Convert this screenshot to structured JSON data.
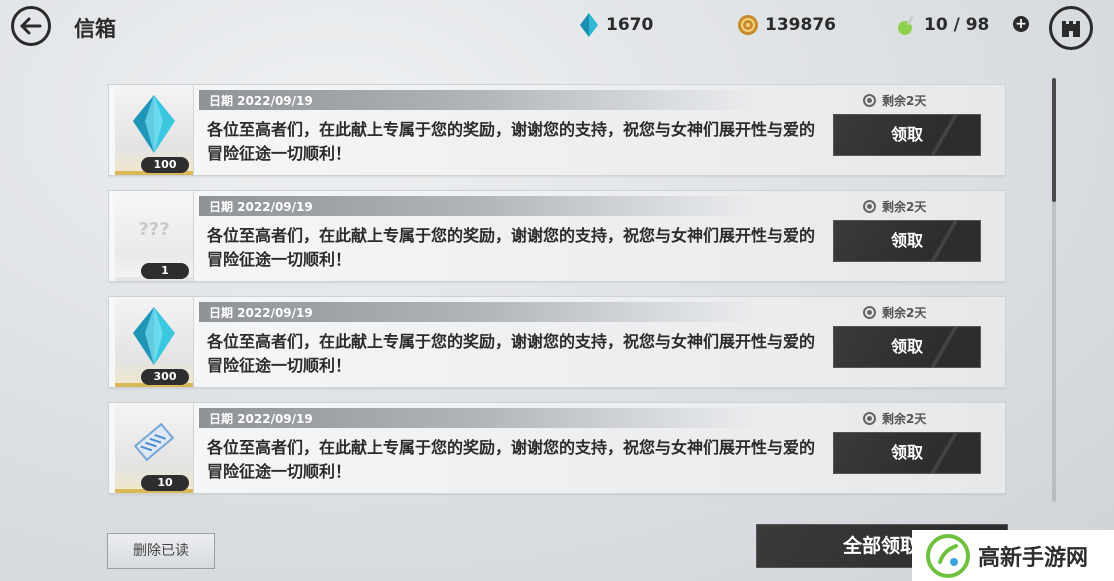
{
  "header": {
    "title": "信箱",
    "back_icon": "back-arrow-icon",
    "castle_icon": "castle-icon"
  },
  "resources": {
    "gems": {
      "icon": "blue-crystal-icon",
      "value": "1670"
    },
    "gold": {
      "icon": "gold-coin-icon",
      "value": "139876"
    },
    "stamina": {
      "icon": "green-potion-icon",
      "value": "10 / 98"
    }
  },
  "mails": [
    {
      "date": "日期 2022/09/19",
      "remaining": "剩余2天",
      "message": "各位至高者们，在此献上专属于您的奖励，谢谢您的支持，祝您与女神们展开性与爱的冒险征途一切顺利！",
      "item_icon": "blue-crystal-icon",
      "count": "100",
      "claim_label": "领取"
    },
    {
      "date": "日期 2022/09/19",
      "remaining": "剩余2天",
      "message": "各位至高者们，在此献上专属于您的奖励，谢谢您的支持，祝您与女神们展开性与爱的冒险征途一切顺利！",
      "item_icon": "mystery-item-icon",
      "item_glyph": "???",
      "count": "1",
      "claim_label": "领取"
    },
    {
      "date": "日期 2022/09/19",
      "remaining": "剩余2天",
      "message": "各位至高者们，在此献上专属于您的奖励，谢谢您的支持，祝您与女神们展开性与爱的冒险征途一切顺利！",
      "item_icon": "blue-crystal-icon",
      "count": "300",
      "claim_label": "领取"
    },
    {
      "date": "日期 2022/09/19",
      "remaining": "剩余2天",
      "message": "各位至高者们，在此献上专属于您的奖励，谢谢您的支持，祝您与女神们展开性与爱的冒险征途一切顺利！",
      "item_icon": "ticket-icon",
      "count": "10",
      "claim_label": "领取"
    }
  ],
  "footer": {
    "delete_read_label": "删除已读",
    "claim_all_label": "全部领取"
  },
  "watermark": {
    "text": "高新手游网",
    "icon": "watermark-logo-icon"
  },
  "colors": {
    "accent_gold": "#d9b85a",
    "button_dark": "#2d2d2d",
    "crystal_blue": "#3cc7e0"
  }
}
